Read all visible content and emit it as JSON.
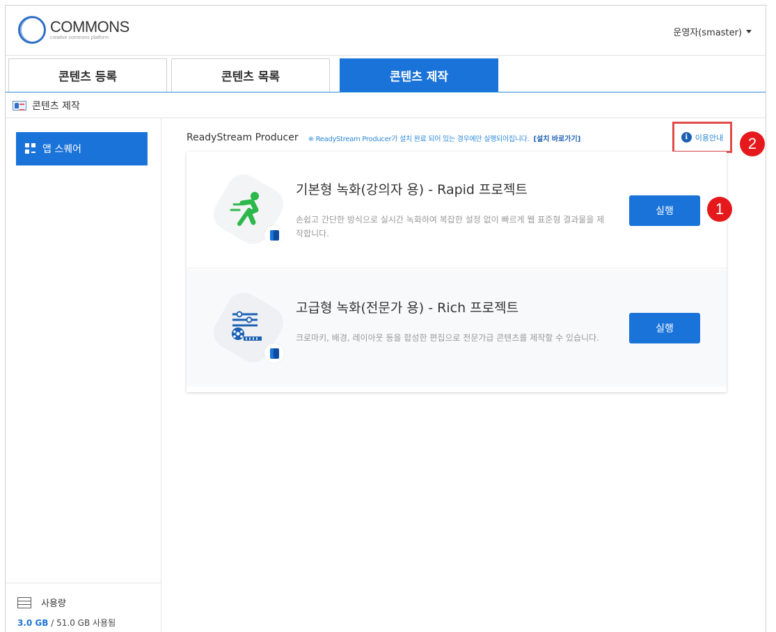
{
  "header": {
    "logo_title": "COMMONS",
    "logo_subtitle": "creative commons platform",
    "user_label": "운영자(smaster)"
  },
  "tabs": [
    {
      "label": "콘텐츠 등록"
    },
    {
      "label": "콘텐츠 목록"
    },
    {
      "label": "콘텐츠 제작",
      "active": true
    }
  ],
  "page_title": "콘텐츠 제작",
  "sidebar": {
    "app_square_label": "앱 스퀘어",
    "usage_label": "사용량",
    "usage_used": "3.0 GB",
    "usage_total": " / 51.0 GB 사용됨"
  },
  "producer": {
    "title": "ReadyStream Producer",
    "note": "※ ReadyStream Producer가 설치 완료 되어 있는 경우에만 실행되어집니다.",
    "install_link": "[설치 바로가기]",
    "guide_label": "이용안내"
  },
  "cards": [
    {
      "title": "기본형 녹화(강의자 용) - Rapid 프로젝트",
      "description": "손쉽고 간단한 방식으로 실시간 녹화하여 복잡한 설정 없이 빠르게 웹 표준형 결과물을 제작합니다.",
      "button_label": "실행",
      "icon": "running-person-icon"
    },
    {
      "title": "고급형 녹화(전문가 용) - Rich 프로젝트",
      "description": "크로마키, 배경, 레이아웃 등을 합성한 편집으로 전문가급 콘텐츠를 제작할 수 있습니다.",
      "button_label": "실행",
      "icon": "film-editor-icon"
    }
  ],
  "annotations": {
    "badge1": "1",
    "badge2": "2"
  },
  "colors": {
    "accent": "#1a73d9",
    "annotation_red": "#e5191c",
    "running_green": "#2cb84a"
  }
}
